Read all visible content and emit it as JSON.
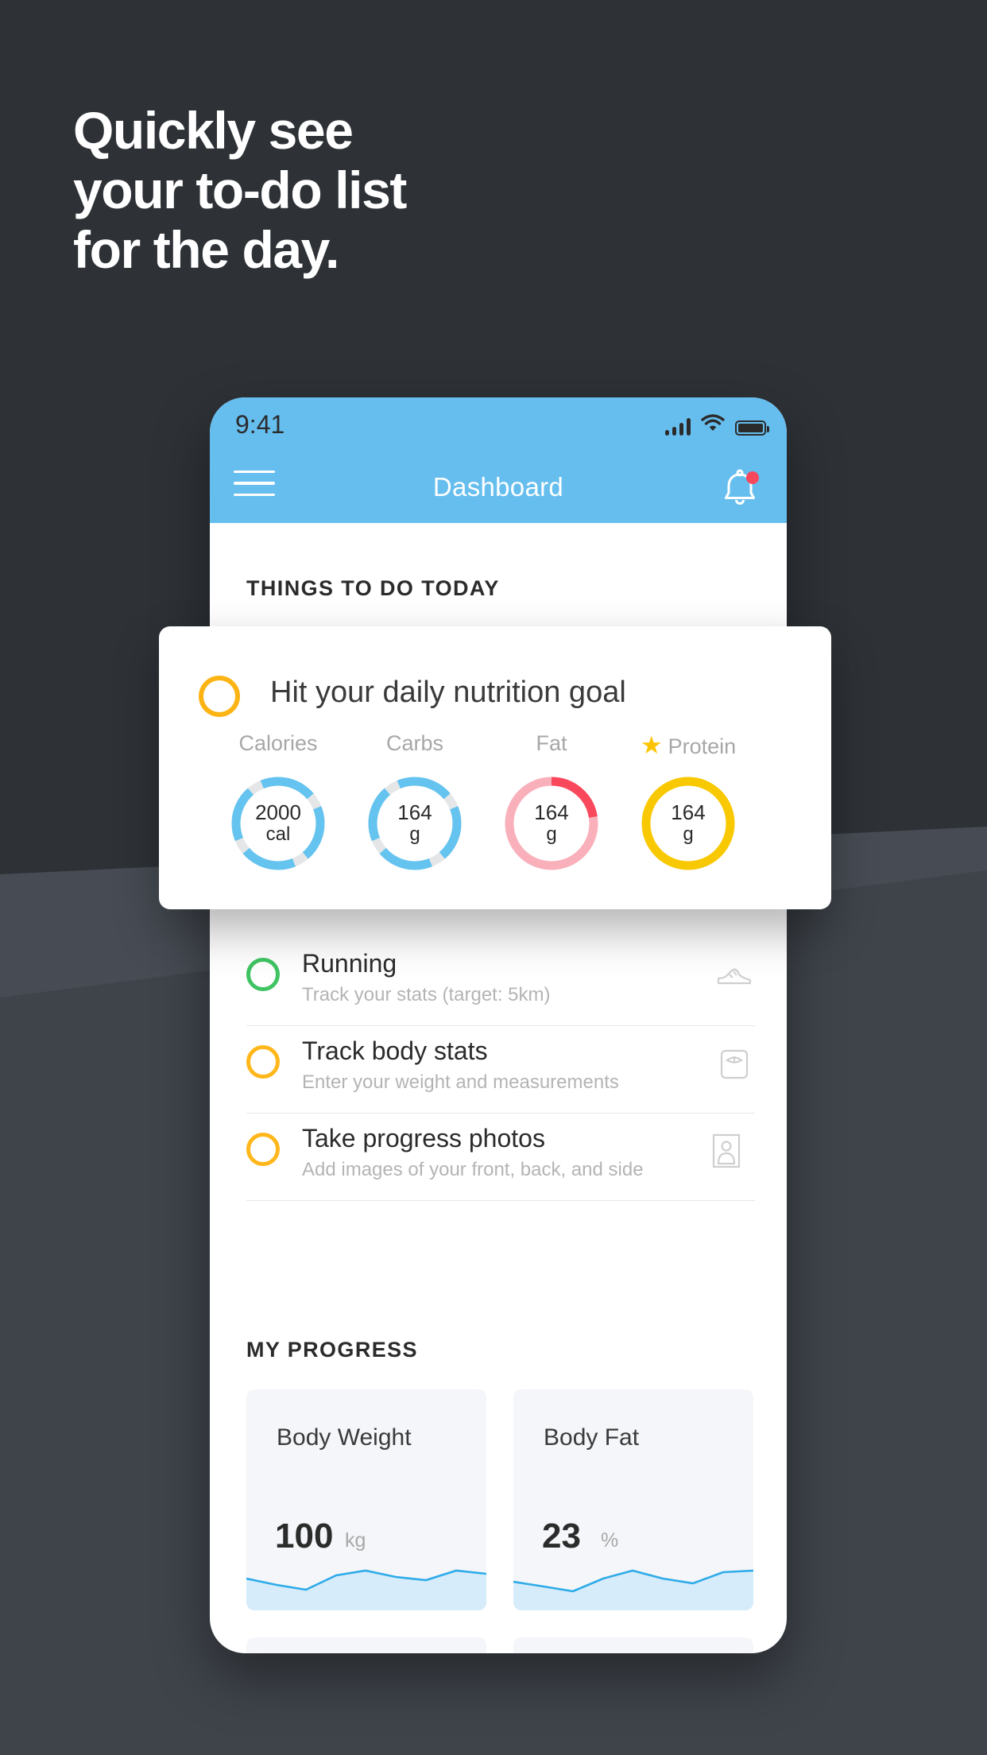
{
  "promo": {
    "headline_lines": [
      "Quickly see",
      "your to-do list",
      "for the day."
    ],
    "bg_color": "#2e3237"
  },
  "phone": {
    "statusbar": {
      "time": "9:41",
      "signal_icon": "signal-bars-icon",
      "wifi_icon": "wifi-icon",
      "battery_icon": "battery-icon"
    },
    "navbar": {
      "menu_icon": "hamburger-menu-icon",
      "title": "Dashboard",
      "notification_icon": "bell-icon",
      "badge_color": "#f9485b",
      "bg_color": "#66beef"
    },
    "sections": {
      "todo_title": "THINGS TO DO TODAY",
      "progress_title": "MY PROGRESS"
    },
    "todo_items": [
      {
        "title": "Running",
        "subtitle": "Track your stats (target: 5km)",
        "ring_color": "#3fc463",
        "icon": "running-shoe-icon"
      },
      {
        "title": "Track body stats",
        "subtitle": "Enter your weight and measurements",
        "ring_color": "#ffb71c",
        "icon": "weight-scale-icon"
      },
      {
        "title": "Take progress photos",
        "subtitle": "Add images of your front, back, and side",
        "ring_color": "#ffb71c",
        "icon": "person-photo-icon"
      }
    ],
    "progress_cards": [
      {
        "label": "Body Weight",
        "value": "100",
        "unit": "kg"
      },
      {
        "label": "Body Fat",
        "value": "23",
        "unit": "%"
      }
    ]
  },
  "overlay_card": {
    "ring_color": "#fcb415",
    "title": "Hit your daily nutrition goal",
    "macros": [
      {
        "label": "Calories",
        "value": "2000",
        "unit": "cal",
        "color": "#64c3ef",
        "starred": false
      },
      {
        "label": "Carbs",
        "value": "164",
        "unit": "g",
        "color": "#64c3ef",
        "starred": false
      },
      {
        "label": "Fat",
        "value": "164",
        "unit": "g",
        "color": "#f98c9a",
        "starred": false
      },
      {
        "label": "Protein",
        "value": "164",
        "unit": "g",
        "color": "#f8c800",
        "starred": true
      }
    ],
    "star_icon": "star-icon"
  },
  "chart_data": [
    {
      "type": "area",
      "title": "Body Weight",
      "values": [
        100,
        99,
        98,
        101,
        103,
        102,
        101,
        103,
        104
      ],
      "ylabel": "kg",
      "grid": false
    },
    {
      "type": "area",
      "title": "Body Fat",
      "values": [
        23,
        22.5,
        22,
        23.5,
        25,
        24,
        23,
        25,
        25.5
      ],
      "ylabel": "%",
      "grid": false
    }
  ]
}
